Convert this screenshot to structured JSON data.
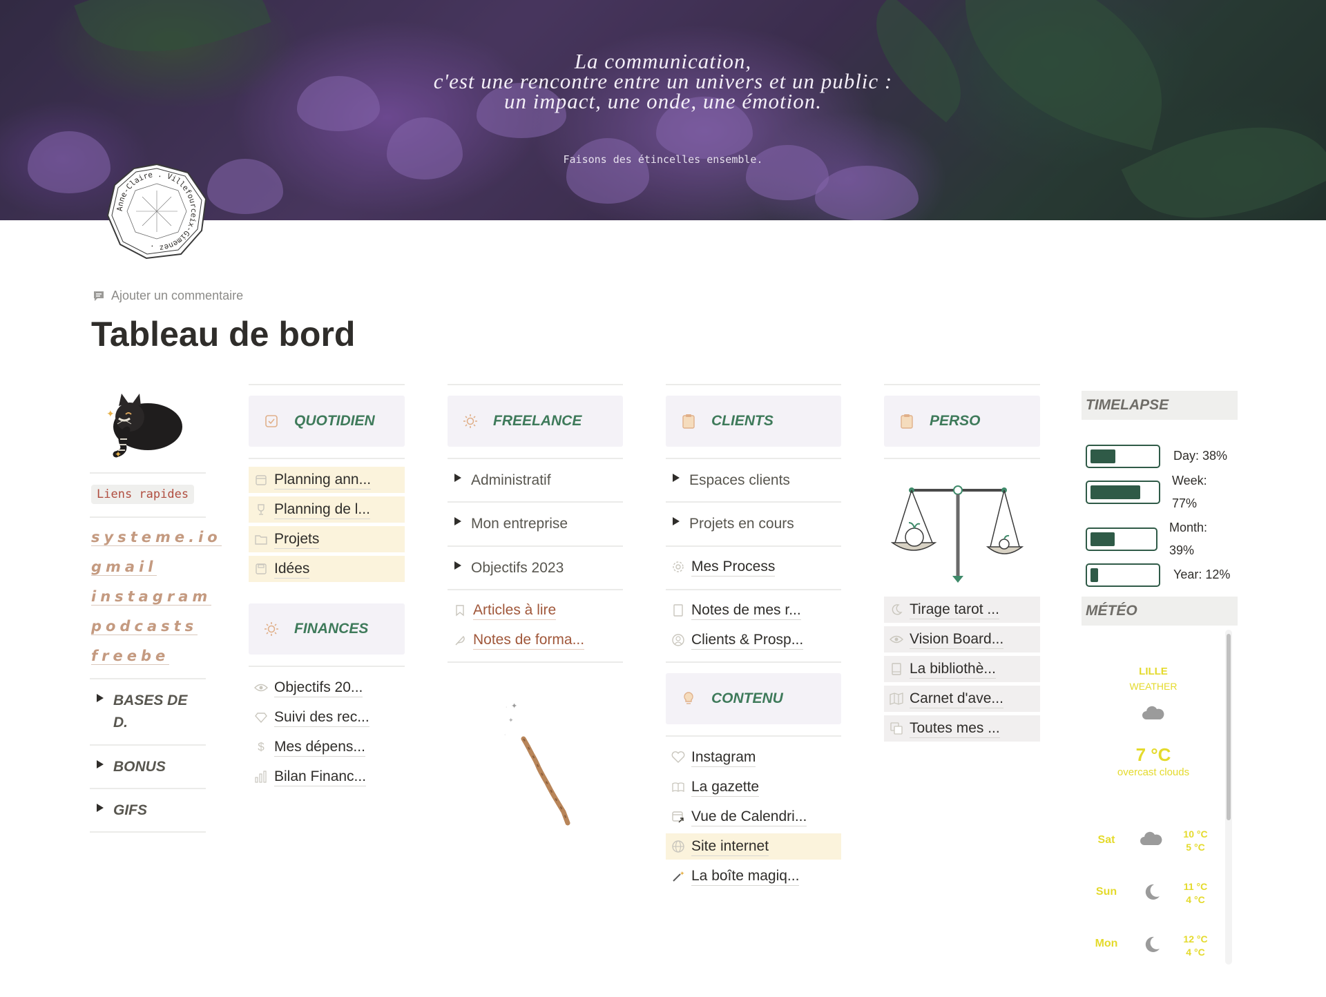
{
  "cover": {
    "quote_lines": [
      "La communication,",
      "c'est une rencontre entre un univers et un public :",
      "un impact, une onde, une émotion."
    ],
    "tagline": "Faisons des étincelles ensemble.",
    "logo_text": "Anne-Claire . Villefourceix-Gimenez ."
  },
  "page": {
    "comment_label": "Ajouter un commentaire",
    "title": "Tableau de bord"
  },
  "quick_links": {
    "tag": "Liens rapides",
    "links": [
      "systeme.io",
      "gmail",
      "instagram",
      "podcasts",
      "freebe"
    ],
    "toggles": [
      "BASES DE D.",
      "BONUS",
      "GIFS"
    ]
  },
  "quotidien": {
    "title": "QUOTIDIEN",
    "items": [
      "Planning ann...",
      "Planning de l...",
      "Projets",
      "Idées"
    ]
  },
  "finances": {
    "title": "FINANCES",
    "items": [
      "Objectifs 20...",
      "Suivi des rec...",
      "Mes dépens...",
      "Bilan Financ..."
    ]
  },
  "freelance": {
    "title": "FREELANCE",
    "toggles": [
      "Administratif",
      "Mon entreprise",
      "Objectifs 2023"
    ],
    "links": [
      "Articles à lire",
      "Notes de forma..."
    ]
  },
  "clients": {
    "title": "CLIENTS",
    "toggles": [
      "Espaces clients",
      "Projets en cours"
    ],
    "process": "Mes Process",
    "links": [
      "Notes de mes r...",
      "Clients & Prosp..."
    ]
  },
  "contenu": {
    "title": "CONTENU",
    "items": [
      "Instagram",
      "La gazette",
      "Vue de Calendri...",
      "Site internet",
      "La boîte magiq..."
    ]
  },
  "perso": {
    "title": "PERSO",
    "items": [
      "Tirage tarot ...",
      "Vision Board...",
      "La bibliothè...",
      "Carnet d'ave...",
      "Toutes mes ..."
    ]
  },
  "timelapse": {
    "title": "TIMELAPSE",
    "rows": [
      {
        "label": "Day: 38%",
        "value": 0.38
      },
      {
        "label_a": "Week:",
        "label_b": "77%",
        "value": 0.77
      },
      {
        "label_a": "Month:",
        "label_b": "39%",
        "value": 0.39
      },
      {
        "label": "Year: 12%",
        "value": 0.12
      }
    ],
    "bar_color": "#2f5a47"
  },
  "weather": {
    "title": "MÉTÉO",
    "city": "LILLE",
    "subtitle": "WEATHER",
    "temp": "7 °C",
    "condition": "overcast clouds",
    "accent_color": "#e4da2c",
    "forecast": [
      {
        "day": "Sat",
        "icon": "cloud-icon",
        "high": "10 °C",
        "low": "5 °C"
      },
      {
        "day": "Sun",
        "icon": "moon-icon",
        "high": "11 °C",
        "low": "4 °C"
      },
      {
        "day": "Mon",
        "icon": "moon-icon",
        "high": "12 °C",
        "low": "4 °C"
      }
    ]
  }
}
